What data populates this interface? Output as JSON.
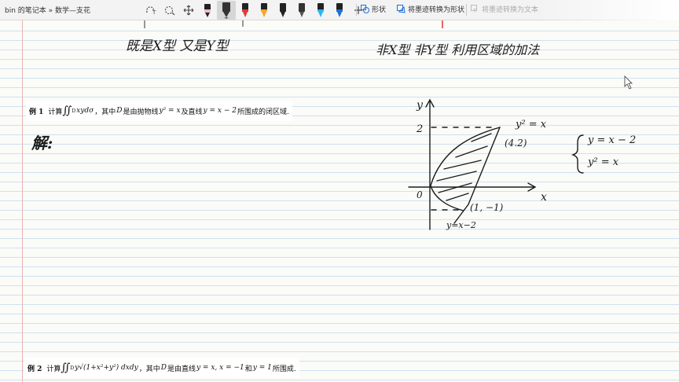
{
  "window": {
    "title": "bin 的笔记本 » 数学—支花"
  },
  "toolbar": {
    "tools": [
      {
        "name": "lasso-select-tool"
      },
      {
        "name": "space-insert-tool"
      },
      {
        "name": "pan-tool"
      },
      {
        "name": "pen-black-thin",
        "color": "#222222"
      },
      {
        "name": "pen-black-selected",
        "color": "#333333"
      },
      {
        "name": "pen-red",
        "color": "#e53935"
      },
      {
        "name": "pen-orange",
        "color": "#f5a623"
      },
      {
        "name": "pen-black-2",
        "color": "#222222"
      },
      {
        "name": "pen-dark-gray",
        "color": "#333333"
      },
      {
        "name": "pen-light-blue",
        "color": "#29b6f6"
      },
      {
        "name": "pen-blue",
        "color": "#1e6fd9"
      },
      {
        "name": "add-pen"
      }
    ],
    "shapes_label": "形状",
    "ink_to_shape_label": "将墨迹转换为形状",
    "ink_to_text_label": "将墨迹转换为文本"
  },
  "notes": {
    "top_left_ink": "既是X型 又是Y型",
    "top_right_ink": "非X型 非Y型  利用区域的加法",
    "jie": "解:",
    "system_line1": "y = x − 2",
    "system_line2": "y² = x"
  },
  "problem1": {
    "label": "例 1",
    "prefix": "计算",
    "integral": "∬",
    "domain": "D",
    "integrand": "xydσ",
    "text1": "，其中",
    "D": "D",
    "text2": "是由抛物线",
    "curve1": "y² = x",
    "text3": "及直线",
    "curve2": "y = x − 2",
    "text4": "所围成的闭区域."
  },
  "problem2": {
    "label": "例 2",
    "prefix": "计算",
    "integral": "∬",
    "domain": "D",
    "integrand": "y√(1+x²+y²) dxdy",
    "text1": "，其中",
    "D": "D",
    "text2": "是由直线",
    "lines": "y = x, x = −1",
    "text3": "和",
    "line3": "y = 1",
    "text4": "所围成."
  },
  "graph": {
    "x_axis": "x",
    "y_axis": "y",
    "origin": "0",
    "y_tick": "2",
    "curve_label_parabola": "y² = x",
    "point_top": "(4.2)",
    "point_bottom": "(1, −1)",
    "line_label": "y=x−2"
  }
}
